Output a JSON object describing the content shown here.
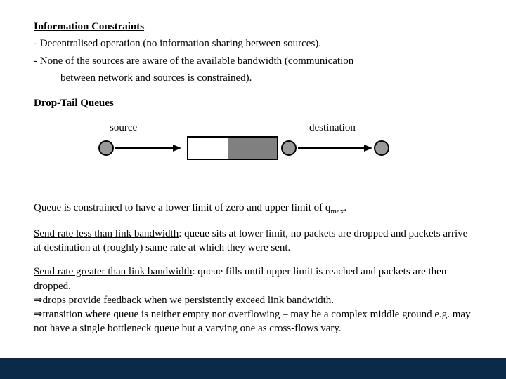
{
  "headings": {
    "info_constraints": "Information Constraints",
    "drop_tail": "Drop-Tail Queues"
  },
  "info_constraints": {
    "bullet1": "- Decentralised operation (no information sharing between sources).",
    "bullet2a": "- None of the sources are aware of the available bandwidth (communication",
    "bullet2b": "between network and sources is constrained)."
  },
  "diagram": {
    "source_label": "source",
    "destination_label": "destination"
  },
  "queue_line": {
    "pre": "Queue is constrained to have a lower limit of zero and upper limit of q",
    "sub": "max",
    "post": "."
  },
  "scenario_less": {
    "title": "Send rate less than link bandwidth",
    "rest": ": queue sits at lower limit, no packets are dropped and packets arrive at destination at (roughly) same rate at which they were sent."
  },
  "scenario_greater": {
    "title": "Send rate greater than link bandwidth",
    "rest": ": queue fills until upper limit is reached and packets are then dropped.",
    "imply1": "⇒drops provide feedback when we persistently exceed link bandwidth.",
    "imply2": "⇒transition where queue is neither empty nor overflowing – may be a complex middle ground e.g. may not have a single bottleneck queue but a varying one as cross-flows vary."
  }
}
